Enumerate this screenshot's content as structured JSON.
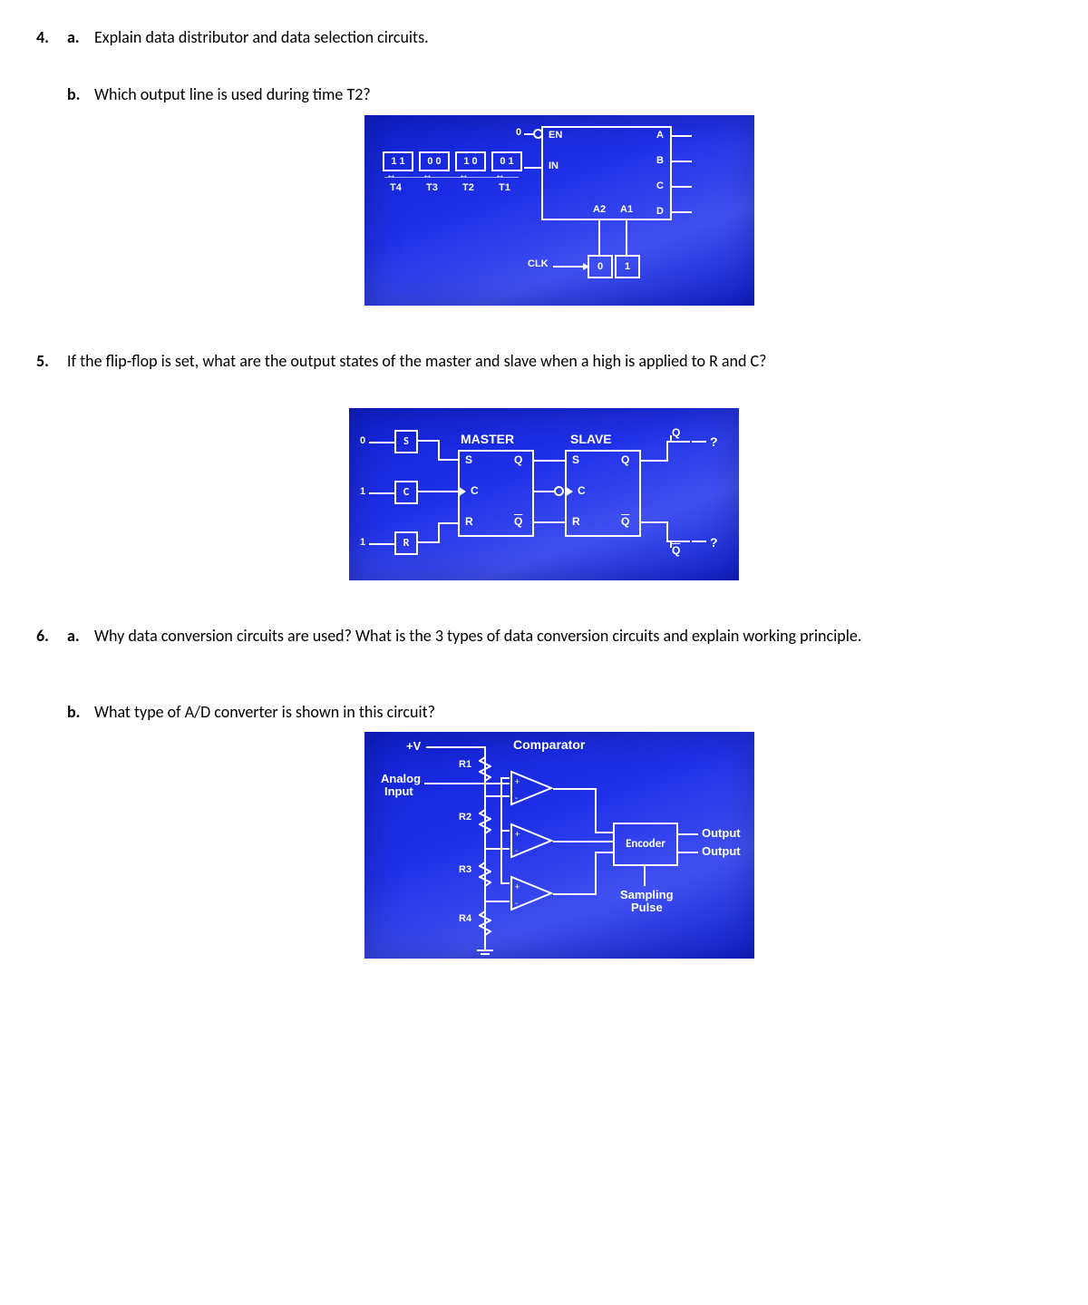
{
  "q4": {
    "num": "4.",
    "a_label": "a.",
    "a_text": "Explain data distributor and data selection circuits.",
    "b_label": "b.",
    "b_text": "Which output line is used during time T2?",
    "fig": {
      "zero": "0",
      "EN": "EN",
      "IN": "IN",
      "t_top": [
        "1 1",
        "0 0",
        "1 0",
        "0 1"
      ],
      "t_bot": [
        "T4",
        "T3",
        "T2",
        "T1"
      ],
      "outs": [
        "A",
        "B",
        "C",
        "D"
      ],
      "A2": "A2",
      "A1": "A1",
      "CLK": "CLK",
      "ctr": [
        "0",
        "1"
      ]
    }
  },
  "q5": {
    "num": "5.",
    "text": "If the flip-flop is set, what are the output states of the master and slave when a high is applied to R and C?",
    "fig": {
      "inputs_val": [
        "0",
        "1",
        "1"
      ],
      "inputs_lbl": [
        "S",
        "C",
        "R"
      ],
      "master": "MASTER",
      "slave": "SLAVE",
      "pins": {
        "S": "S",
        "Q": "Q",
        "C": "C",
        "R": "R",
        "Qb": "Q"
      },
      "outQ": "Q",
      "outQb": "Q",
      "qmark": "?"
    }
  },
  "q6": {
    "num": "6.",
    "a_label": "a.",
    "a_text": "Why data conversion circuits are used? What is the 3 types of data conversion circuits and explain working principle.",
    "b_label": "b.",
    "b_text": "What type of A/D converter is shown in this circuit?",
    "fig": {
      "plusV": "+V",
      "analog": "Analog",
      "input": "Input",
      "comparator": "Comparator",
      "Rs": [
        "R1",
        "R2",
        "R3",
        "R4"
      ],
      "encoder": "Encoder",
      "output": "Output",
      "sampling": "Sampling",
      "pulse": "Pulse"
    }
  }
}
